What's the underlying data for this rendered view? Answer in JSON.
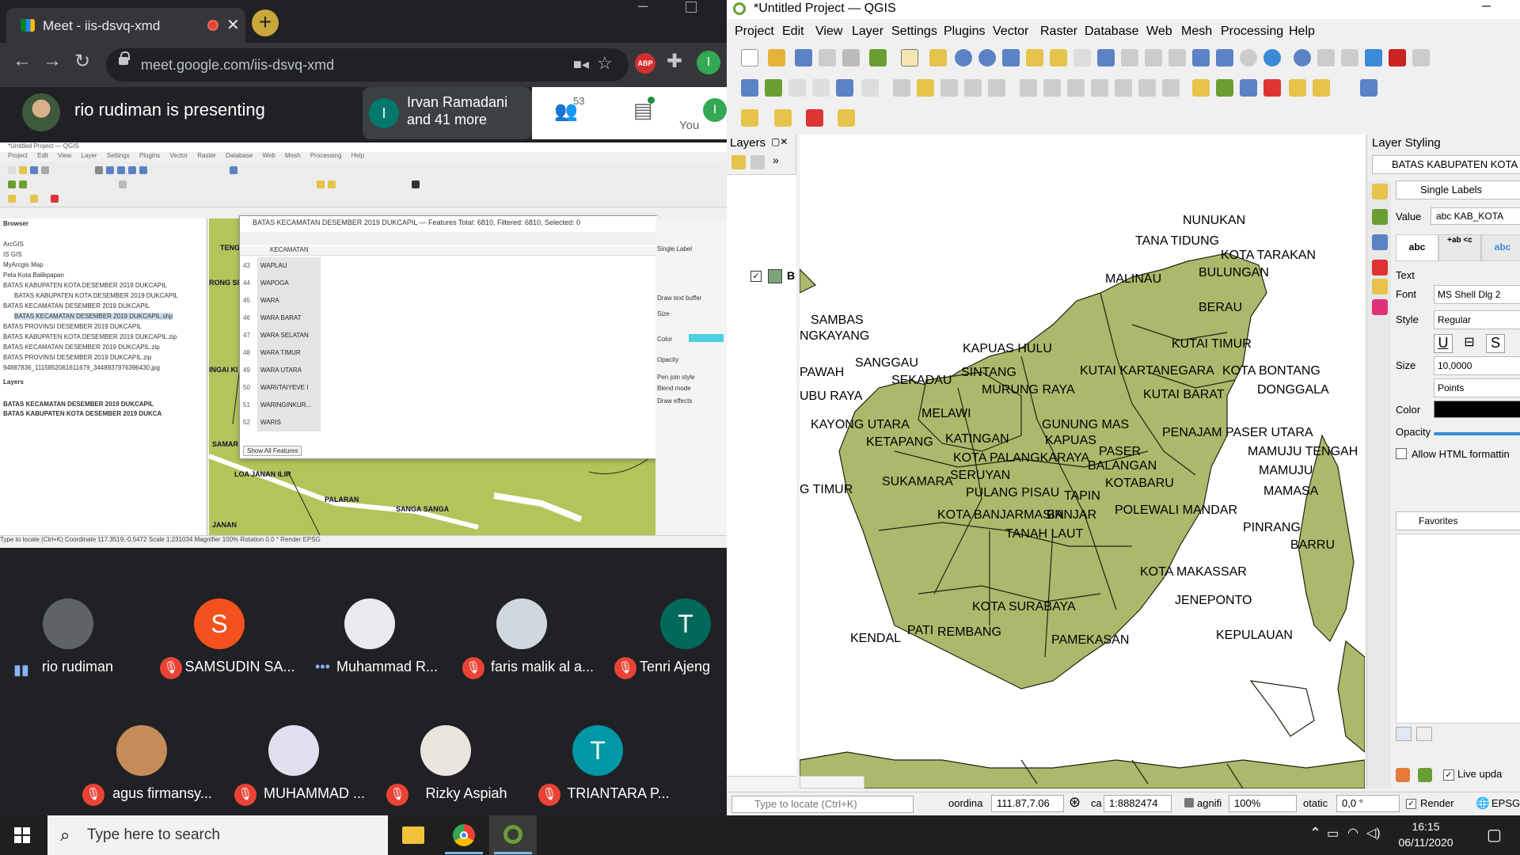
{
  "chrome": {
    "tab_title": "Meet - iis-dsvq-xmd",
    "tab_close": "✕",
    "new_tab": "+",
    "url": "meet.google.com/iis-dsvq-xmd",
    "ext_abp": "ABP",
    "profile_initial": "I"
  },
  "meet": {
    "presenting_text": "rio rudiman is presenting",
    "participants_card": {
      "initial": "I",
      "name": "Irvan Ramadani",
      "more": "and 41 more"
    },
    "people_count": "53",
    "you_label": "You",
    "you_initial": "I",
    "tiles_row1": [
      {
        "name": "rio rudiman",
        "initial": "",
        "color": "#5f6368",
        "muted": false,
        "speaking": true
      },
      {
        "name": "SAMSUDIN SA...",
        "initial": "S",
        "color": "#f4511e",
        "muted": true
      },
      {
        "name": "Muhammad R...",
        "initial": "",
        "color": "#e8eaed",
        "muted": false,
        "more": true
      },
      {
        "name": "faris malik al a...",
        "initial": "",
        "color": "#cfd8dc",
        "muted": true
      },
      {
        "name": "Tenri Ajeng",
        "initial": "T",
        "color": "#00695c",
        "muted": true
      }
    ],
    "tiles_row2": [
      {
        "name": "agus firmansy...",
        "initial": "",
        "color": "#c58c5a",
        "muted": true
      },
      {
        "name": "MUHAMMAD ...",
        "initial": "",
        "color": "#e0e0f0",
        "muted": true
      },
      {
        "name": "Rizky Aspiah",
        "initial": "",
        "color": "#e8e4de",
        "muted": true
      },
      {
        "name": "TRIANTARA P...",
        "initial": "T",
        "color": "#0097a7",
        "muted": true
      }
    ]
  },
  "shared_screen": {
    "title": "*Untitled Project — QGIS",
    "menu": "Project Edit View Layer Settings Plugins Vector Raster Database Web Mesh Processing Help",
    "browser_title": "Browser",
    "browser_items": [
      "ArcGIS",
      "IS GIS",
      "MyArcgis Map",
      "Peta Kota Balikpapan",
      "BATAS KABUPATEN KOTA DESEMBER 2019 DUKCAPIL",
      "BATAS KABUPATEN KOTA DESEMBER 2019 DUKCAPIL",
      "BATAS KECAMATAN DESEMBER 2019 DUKCAPIL",
      "BATAS KECAMATAN DESEMBER 2019 DUKCAPIL.shp",
      "BATAS PROVINSI DESEMBER 2019 DUKCAPIL",
      "BATAS KABUPATEN KOTA DESEMBER 2019 DUKCAPIL.zip",
      "BATAS KECAMATAN DESEMBER 2019 DUKCAPIL.zip",
      "BATAS PROVINSI DESEMBER 2019 DUKCAPIL.zip",
      "94887836_1115852061611679_3448937976396430.jpg"
    ],
    "layers_title": "Layers",
    "layers": [
      "BATAS KECAMATAN DESEMBER 2019 DUKCAPIL",
      "BATAS KABUPATEN KOTA DESEMBER 2019 DUKCA"
    ],
    "attr_title": "BATAS KECAMATAN DESEMBER 2019 DUKCAPIL — Features Total: 6810, Filtered: 6810, Selected: 0",
    "attr_column": "KECAMATAN",
    "attr_rows": [
      {
        "n": "43",
        "v": "WAPLAU"
      },
      {
        "n": "44",
        "v": "WAPOGA"
      },
      {
        "n": "45",
        "v": "WARA"
      },
      {
        "n": "46",
        "v": "WARA BARAT"
      },
      {
        "n": "47",
        "v": "WARA SELATAN"
      },
      {
        "n": "48",
        "v": "WARA TIMUR"
      },
      {
        "n": "49",
        "v": "WARA UTARA"
      },
      {
        "n": "50",
        "v": "WARI/TAIYEVE I"
      },
      {
        "n": "51",
        "v": "WARINGINKUR..."
      },
      {
        "n": "52",
        "v": "WARIS"
      }
    ],
    "attr_footer": "Show All Features",
    "map_labels": [
      "TENG",
      "RONG SI",
      "INGAI KI",
      "SAMAR",
      "LOA JANAN ILIR",
      "PALARAN",
      "SANGA SANGA",
      "JANAN"
    ],
    "styling_items": [
      "Single Label",
      "Draw text buffer",
      "Size",
      "Color",
      "Opacity",
      "Pen join style",
      "Blend mode",
      "Draw effects"
    ],
    "status": "Type to locate (Ctrl+K)     Coordinate 117.3519,-0.5472     Scale 1:231034     Magnifier 100%     Rotation 0.0 °     Render   EPSG"
  },
  "qgis": {
    "title": "*Untitled Project — QGIS",
    "minimize": "–",
    "menu": [
      "Project",
      "Edit",
      "View",
      "Layer",
      "Settings",
      "Plugins",
      "Vector",
      "Raster",
      "Database",
      "Web",
      "Mesh",
      "Processing",
      "Help"
    ],
    "layers_title": "Layers",
    "layer_name": "B",
    "layer_checked": "✓",
    "styling_title": "Layer Styling",
    "styling_layer": "BATAS KABUPATEN KOTA D",
    "label_mode": "Single Labels",
    "value_label": "Value",
    "value": "abc KAB_KOTA",
    "tabs": [
      "abc",
      "+ab\n<c",
      "abc"
    ],
    "text_header": "Text",
    "font_label": "Font",
    "font_value": "MS Shell Dlg 2",
    "style_label": "Style",
    "style_value": "Regular",
    "size_label": "Size",
    "size_value": "10,0000",
    "size_unit": "Points",
    "color_label": "Color",
    "opacity_label": "Opacity",
    "html_label": "Allow HTML formattin",
    "favorites": "Favorites",
    "live_update": "Live upda",
    "map_labels": [
      "NUNUKAN",
      "TANA TIDUNG",
      "KOTA TARAKAN",
      "MALINAU",
      "BULUNGAN",
      "BERAU",
      "SAMBAS",
      "NGKAYANG",
      "KUTAI TIMUR",
      "KAPUAS HULU",
      "SANGGAU",
      "SINTANG",
      "KUTAI KARTANEGARA",
      "KOTA BONTANG",
      "PAWAH",
      "SEKADAU",
      "MURUNG RAYA",
      "DONGGALA",
      "UBU RAYA",
      "KUTAI BARAT",
      "MELAWI",
      "GUNUNG MAS",
      "KAYONG UTARA",
      "PENAJAM PASER UTARA",
      "KETAPANG",
      "KATINGAN",
      "KAPUAS",
      "MAMUJU TENGAH",
      "KOTA PALANGKARAYA",
      "PASER",
      "BALANGAN",
      "MAMUJU",
      "SERUYAN",
      "SUKAMARA",
      "KOTABARU",
      "G TIMUR",
      "PULANG PISAU",
      "MAMASA",
      "TAPIN",
      "POLEWALI MANDAR",
      "KOTA BANJARMASIN",
      "BANJAR",
      "PINRANG",
      "TANAH LAUT",
      "BARRU",
      "KOTA MAKASSAR",
      "JENEPONTO",
      "KOTA SURABAYA",
      "KENDAL",
      "PATI",
      "REMBANG",
      "PAMEKASAN",
      "KEPULAUAN"
    ],
    "status": {
      "locate": "Type to locate (Ctrl+K)",
      "coord_label": "oordina",
      "coord": "111.87,7.06",
      "scale_label": "ca",
      "scale": "1:8882474",
      "magnifier_label": "agnifi",
      "magnifier": "100%",
      "rotation_label": "otatic",
      "rotation": "0,0 °",
      "render": "Render",
      "crs": "EPSG"
    }
  },
  "taskbar": {
    "search_placeholder": "Type here to search",
    "time": "16:15",
    "date": "06/11/2020"
  }
}
